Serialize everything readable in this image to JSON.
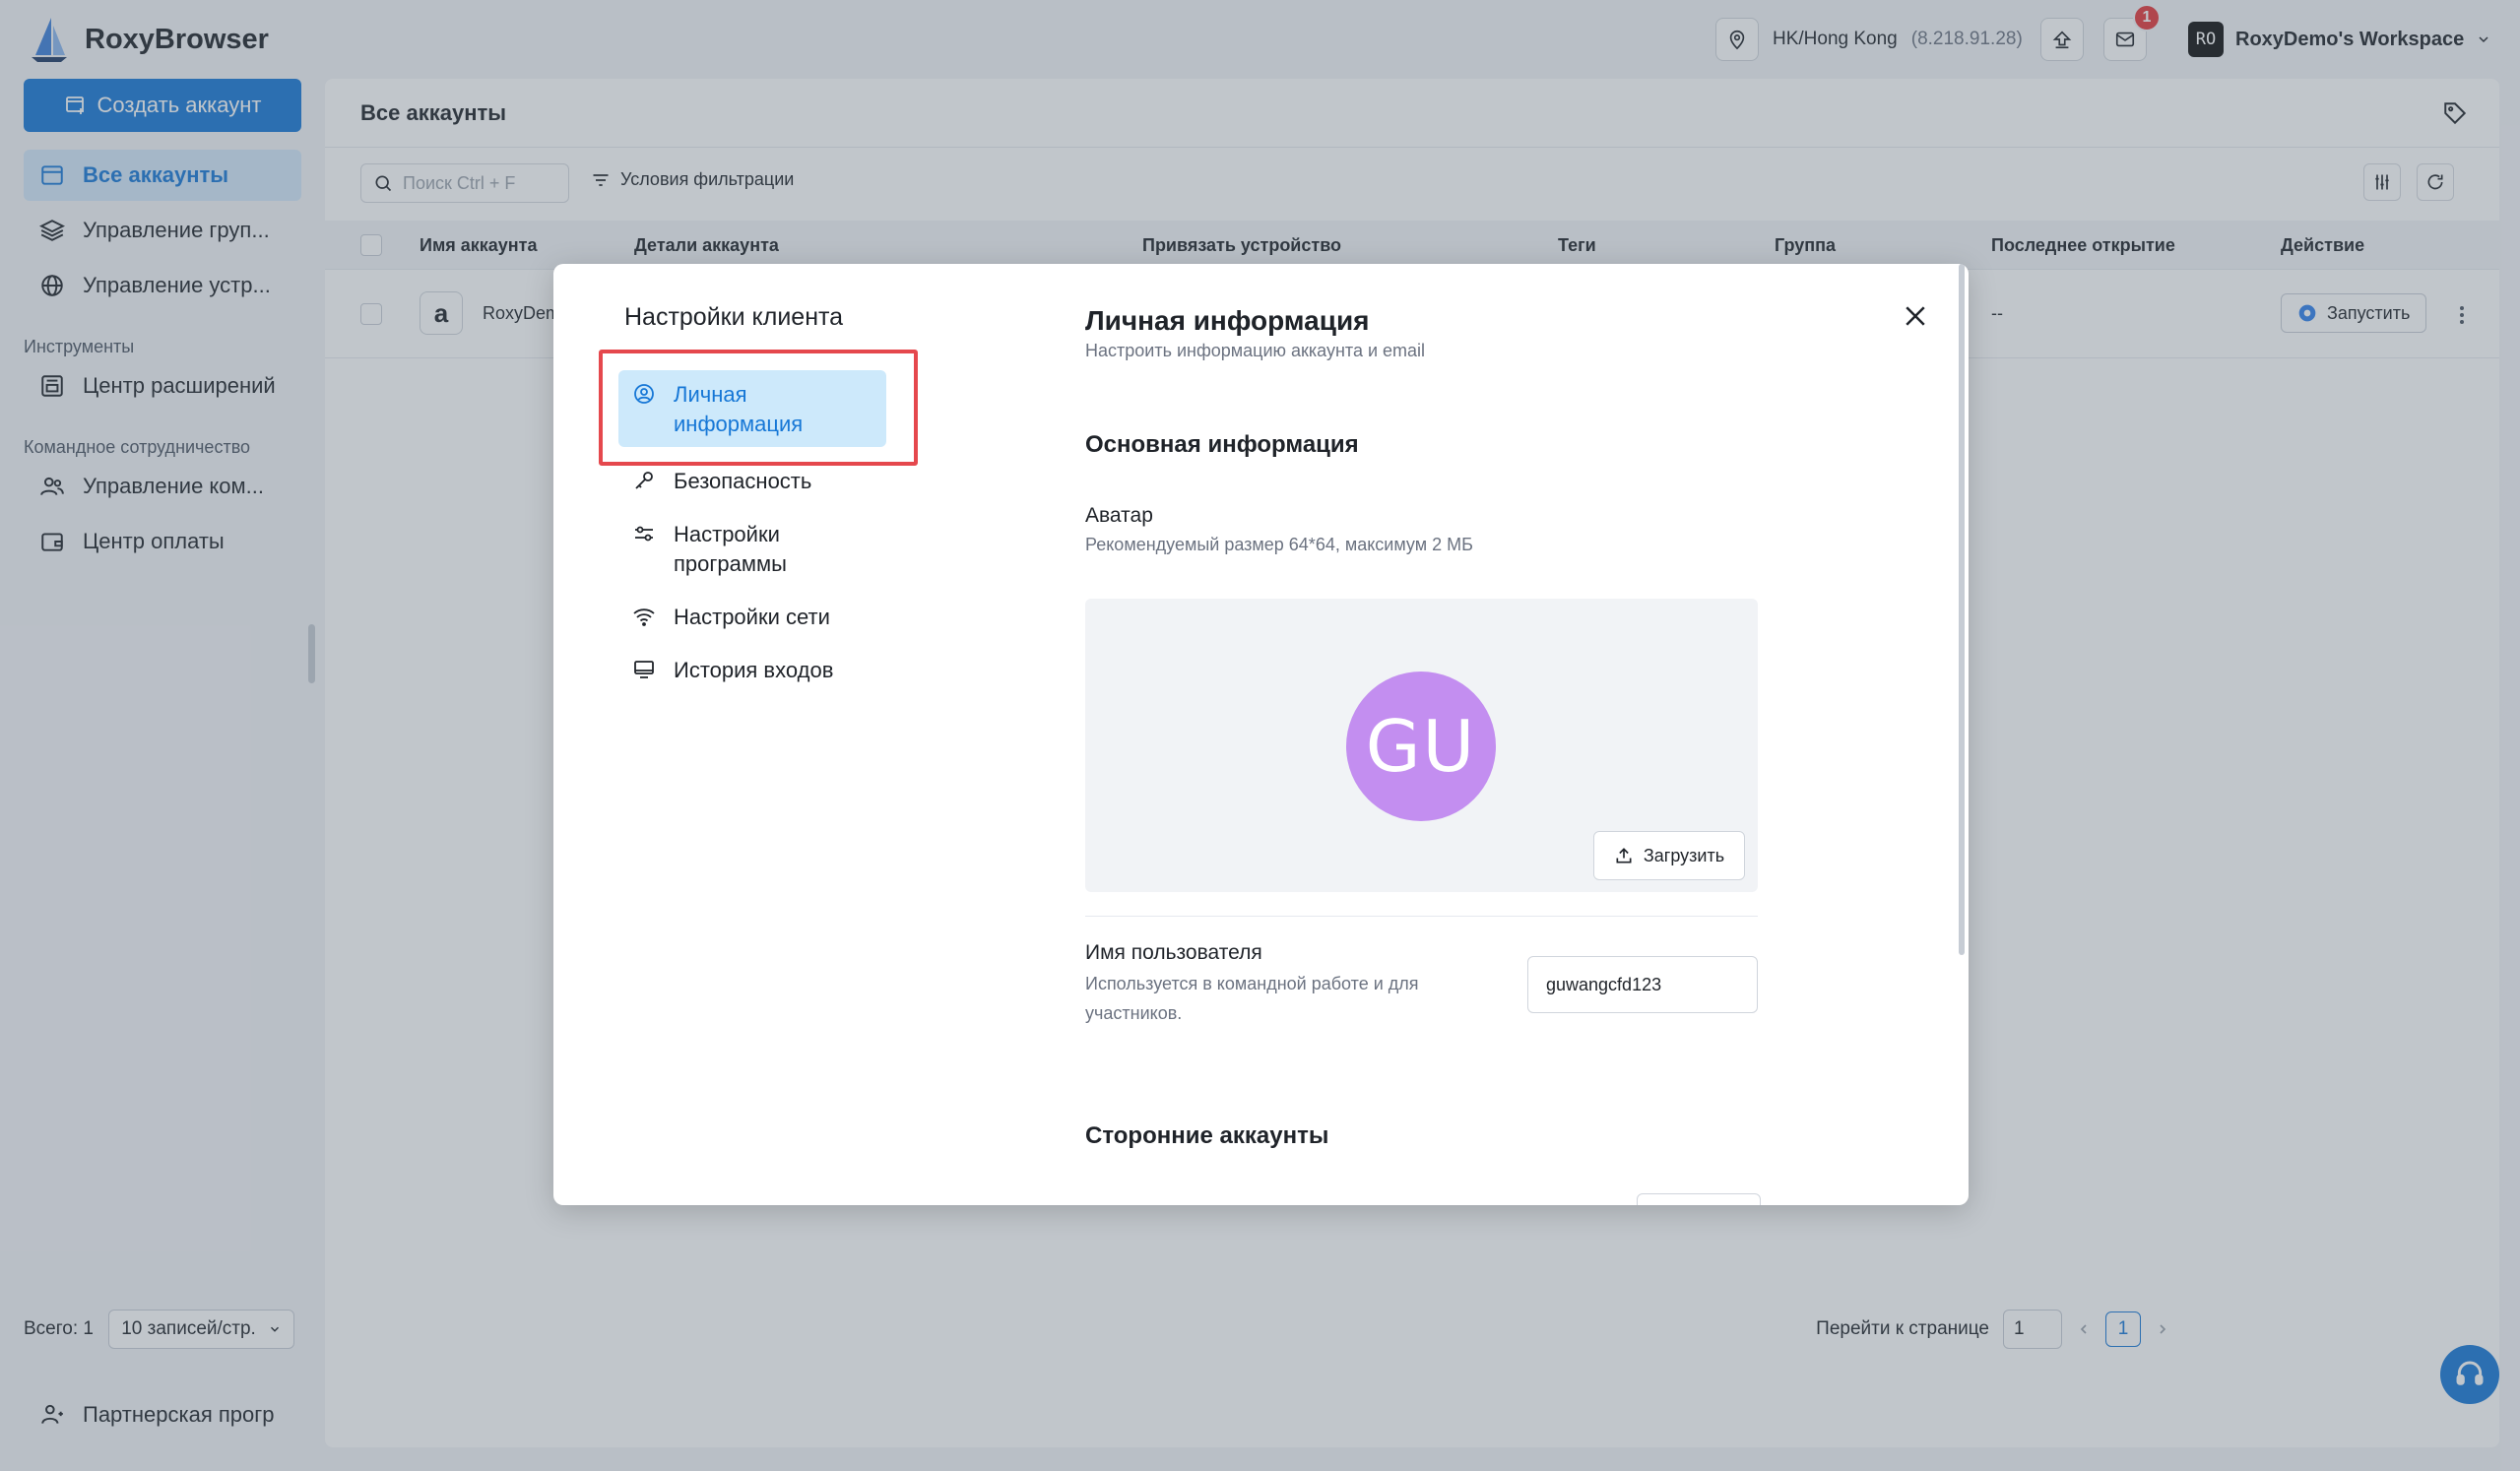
{
  "app": {
    "name": "RoxyBrowser"
  },
  "topbar": {
    "location": "HK/Hong Kong",
    "ip": "(8.218.91.28)",
    "notification_count": "1",
    "workspace_avatar": "RO",
    "workspace_name": "RoxyDemo's Workspace"
  },
  "sidebar": {
    "create_button": "Создать аккаунт",
    "items": [
      {
        "label": "Все аккаунты",
        "icon": "browser-window-icon",
        "active": true
      },
      {
        "label": "Управление груп...",
        "icon": "layers-icon"
      },
      {
        "label": "Управление устр...",
        "icon": "globe-icon"
      }
    ],
    "section_tools": "Инструменты",
    "tools_items": [
      {
        "label": "Центр расширений",
        "icon": "extensions-icon"
      }
    ],
    "section_team": "Командное сотрудничество",
    "team_items": [
      {
        "label": "Управление ком...",
        "icon": "team-icon"
      },
      {
        "label": "Центр оплаты",
        "icon": "wallet-icon"
      }
    ],
    "partner": "Партнерская прогр"
  },
  "main": {
    "title": "Все аккаунты",
    "search_placeholder": "Поиск Ctrl + F",
    "filter_label": "Условия фильтрации",
    "columns": [
      "Имя аккаунта",
      "Детали аккаунта",
      "Привязать устройство",
      "Теги",
      "Группа",
      "Последнее открытие",
      "Действие"
    ],
    "row": {
      "account_name": "RoxyDem",
      "last_opened": "--",
      "launch": "Запустить"
    },
    "footer": {
      "total": "Всего: 1",
      "page_size": "10 записей/стр.",
      "goto_label": "Перейти к странице",
      "goto_value": "1",
      "current_page": "1"
    }
  },
  "modal": {
    "nav_title": "Настройки клиента",
    "nav": [
      {
        "label": "Личная информация",
        "icon": "user-circle-icon",
        "active": true
      },
      {
        "label": "Безопасность",
        "icon": "key-icon"
      },
      {
        "label": "Настройки программы",
        "icon": "sliders-icon"
      },
      {
        "label": "Настройки сети",
        "icon": "wifi-icon"
      },
      {
        "label": "История входов",
        "icon": "monitor-icon"
      }
    ],
    "title": "Личная информация",
    "subtitle": "Настроить информацию аккаунта и email",
    "section_basic": "Основная информация",
    "avatar_label": "Аватар",
    "avatar_hint": "Рекомендуемый размер 64*64, максимум 2 МБ",
    "avatar_initials": "GU",
    "avatar_color": "#c38ef0",
    "upload_button": "Загрузить",
    "username_label": "Имя пользователя",
    "username_hint": "Используется в командной работе и для участников.",
    "username_value": "guwangcfd123",
    "section_third_party": "Сторонние аккаунты"
  }
}
